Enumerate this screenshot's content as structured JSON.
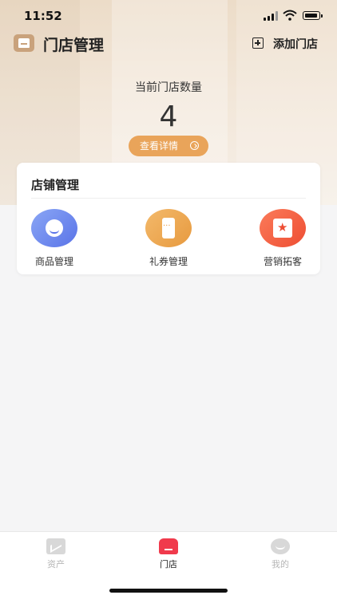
{
  "status_bar": {
    "time": "11:52"
  },
  "nav": {
    "title": "门店管理",
    "add_label": "添加门店"
  },
  "summary": {
    "count_label": "当前门店数量",
    "count_value": "4",
    "detail_button": "查看详情"
  },
  "card": {
    "title": "店铺管理",
    "items": [
      {
        "label": "商品管理",
        "icon": "face-icon"
      },
      {
        "label": "礼券管理",
        "icon": "coupon-icon"
      },
      {
        "label": "营销拓客",
        "icon": "star-badge-icon"
      }
    ]
  },
  "tabbar": {
    "tabs": [
      {
        "label": "资产",
        "icon": "chart-icon"
      },
      {
        "label": "门店",
        "icon": "store-icon"
      },
      {
        "label": "我的",
        "icon": "smile-icon"
      }
    ],
    "active": "门店"
  },
  "colors": {
    "accent": "#f03a4c",
    "detail_button": "#e9a45a",
    "hero": "#ecdcc8"
  }
}
